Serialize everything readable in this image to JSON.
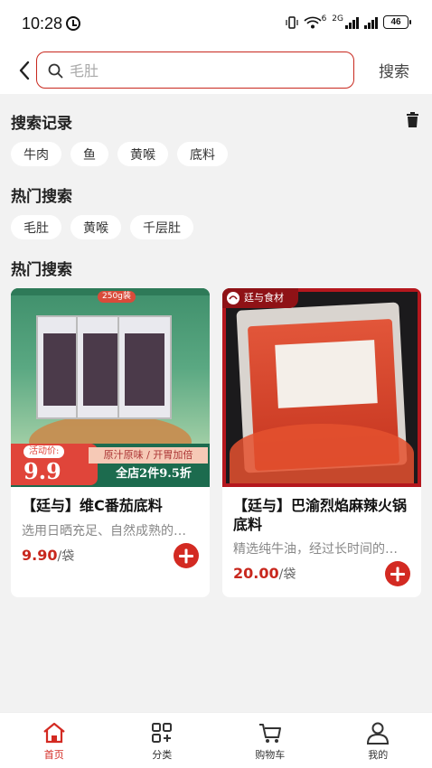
{
  "status": {
    "time": "10:28",
    "signal_1": "6",
    "signal_2": "2G",
    "battery": "46"
  },
  "search": {
    "placeholder": "毛肚",
    "button_label": "搜索"
  },
  "history": {
    "title": "搜索记录",
    "items": [
      "牛肉",
      "鱼",
      "黄喉",
      "底料"
    ]
  },
  "hot": {
    "title": "热门搜索",
    "items": [
      "毛肚",
      "黄喉",
      "千层肚"
    ]
  },
  "products_section": {
    "title": "热门搜索"
  },
  "products": [
    {
      "name": "【廷与】维C番茄底料",
      "desc": "选用日晒充足、自然成熟的…",
      "price": "9.90",
      "unit": "/袋",
      "image_text": {
        "weight_tag": "250g装",
        "promo_label": "活动价:",
        "promo_price": "9.9",
        "slogan": "原汁原味 / 开胃加倍",
        "discount": "全店2件9.5折"
      }
    },
    {
      "name": "【廷与】巴渝烈焰麻辣火锅底料",
      "desc": "精选纯牛油，经过长时间的…",
      "price": "20.00",
      "unit": "/袋",
      "image_text": {
        "brand": "廷与食材"
      }
    }
  ],
  "tabs": [
    {
      "label": "首页",
      "icon": "home-icon",
      "active": true
    },
    {
      "label": "分类",
      "icon": "category-icon",
      "active": false
    },
    {
      "label": "购物车",
      "icon": "cart-icon",
      "active": false
    },
    {
      "label": "我的",
      "icon": "user-icon",
      "active": false
    }
  ],
  "colors": {
    "accent": "#d32a22",
    "background": "#f2f2f2"
  }
}
